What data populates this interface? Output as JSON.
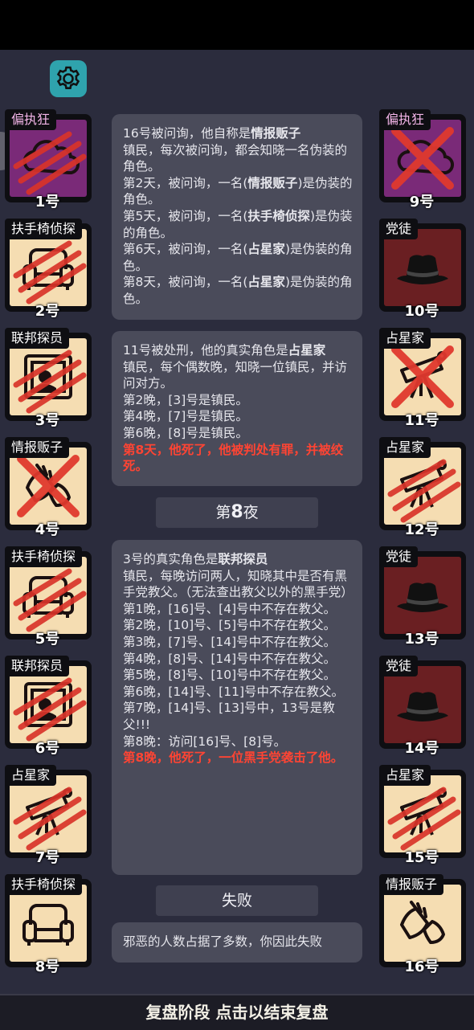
{
  "left_players": [
    {
      "role": "偏执狂",
      "number": "1号",
      "faction": "neutral",
      "status": "claw",
      "icon": "cloud-icon"
    },
    {
      "role": "扶手椅侦探",
      "number": "2号",
      "faction": "town",
      "status": "claw",
      "icon": "armchair-icon"
    },
    {
      "role": "联邦探员",
      "number": "3号",
      "faction": "town",
      "status": "claw",
      "icon": "badge-icon"
    },
    {
      "role": "情报贩子",
      "number": "4号",
      "faction": "town",
      "status": "x",
      "icon": "hand-phone-icon"
    },
    {
      "role": "扶手椅侦探",
      "number": "5号",
      "faction": "town",
      "status": "claw",
      "icon": "armchair-icon"
    },
    {
      "role": "联邦探员",
      "number": "6号",
      "faction": "town",
      "status": "claw",
      "icon": "badge-icon"
    },
    {
      "role": "占星家",
      "number": "7号",
      "faction": "town",
      "status": "claw",
      "icon": "telescope-icon"
    },
    {
      "role": "扶手椅侦探",
      "number": "8号",
      "faction": "town",
      "status": "alive",
      "icon": "armchair-icon"
    }
  ],
  "right_players": [
    {
      "role": "偏执狂",
      "number": "9号",
      "faction": "neutral",
      "status": "x",
      "icon": "cloud-icon"
    },
    {
      "role": "党徒",
      "number": "10号",
      "faction": "mafia",
      "status": "alive",
      "icon": "fedora-icon"
    },
    {
      "role": "占星家",
      "number": "11号",
      "faction": "town",
      "status": "x",
      "icon": "telescope-icon"
    },
    {
      "role": "占星家",
      "number": "12号",
      "faction": "town",
      "status": "claw",
      "icon": "telescope-icon"
    },
    {
      "role": "党徒",
      "number": "13号",
      "faction": "mafia",
      "status": "alive",
      "icon": "fedora-icon"
    },
    {
      "role": "党徒",
      "number": "14号",
      "faction": "mafia",
      "status": "alive",
      "icon": "fedora-icon"
    },
    {
      "role": "占星家",
      "number": "15号",
      "faction": "town",
      "status": "claw",
      "icon": "telescope-icon"
    },
    {
      "role": "情报贩子",
      "number": "16号",
      "faction": "town",
      "status": "alive",
      "icon": "hand-phone-icon"
    }
  ],
  "panel1": {
    "l1a": "16号被问询，他自称是",
    "l1b": "情报贩子",
    "l2": "镇民，每次被问询，都会知晓一名伪装的角色。",
    "l3a": "第2天，被问询，一名(",
    "l3b": "情报贩子",
    "l3c": ")是伪装的角色。",
    "l4a": "第5天，被问询，一名(",
    "l4b": "扶手椅侦探",
    "l4c": ")是伪装的角色。",
    "l5a": "第6天，被问询，一名(",
    "l5b": "占星家",
    "l5c": ")是伪装的角色。",
    "l6a": "第8天，被问询，一名(",
    "l6b": "占星家",
    "l6c": ")是伪装的角色。"
  },
  "panel2": {
    "l1a": "11号被处刑，他的真实角色是",
    "l1b": "占星家",
    "l2": "镇民，每个偶数晚，知晓一位镇民，并访问对方。",
    "l3": "第2晚，[3]号是镇民。",
    "l4": "第4晚，[7]号是镇民。",
    "l5": "第6晚，[8]号是镇民。",
    "l6": "第8天，他死了，他被判处有罪，并被绞死。"
  },
  "night_label_a": "第",
  "night_label_b": "8",
  "night_label_c": "夜",
  "panel3": {
    "l1a": "3号的真实角色是",
    "l1b": "联邦探员",
    "l2": "镇民，每晚访问两人，知晓其中是否有黑手党教父。（无法查出教父以外的黑手党）",
    "l3": "第1晚，[16]号、[4]号中不存在教父。",
    "l4": "第2晚，[10]号、[5]号中不存在教父。",
    "l5": "第3晚，[7]号、[14]号中不存在教父。",
    "l6": "第4晚，[8]号、[14]号中不存在教父。",
    "l7": "第5晚，[8]号、[10]号中不存在教父。",
    "l8": "第6晚，[14]号、[11]号中不存在教父。",
    "l9": "第7晚，[14]号、[13]号中，13号是教父!!!",
    "l10": "第8晚：访问[16]号、[8]号。",
    "l11": "第8晚，他死了，一位黑手党袭击了他。"
  },
  "result_label": "失败",
  "result_text": "邪恶的人数占据了多数，你因此失败",
  "bottom_button": "复盘阶段 点击以结束复盘"
}
